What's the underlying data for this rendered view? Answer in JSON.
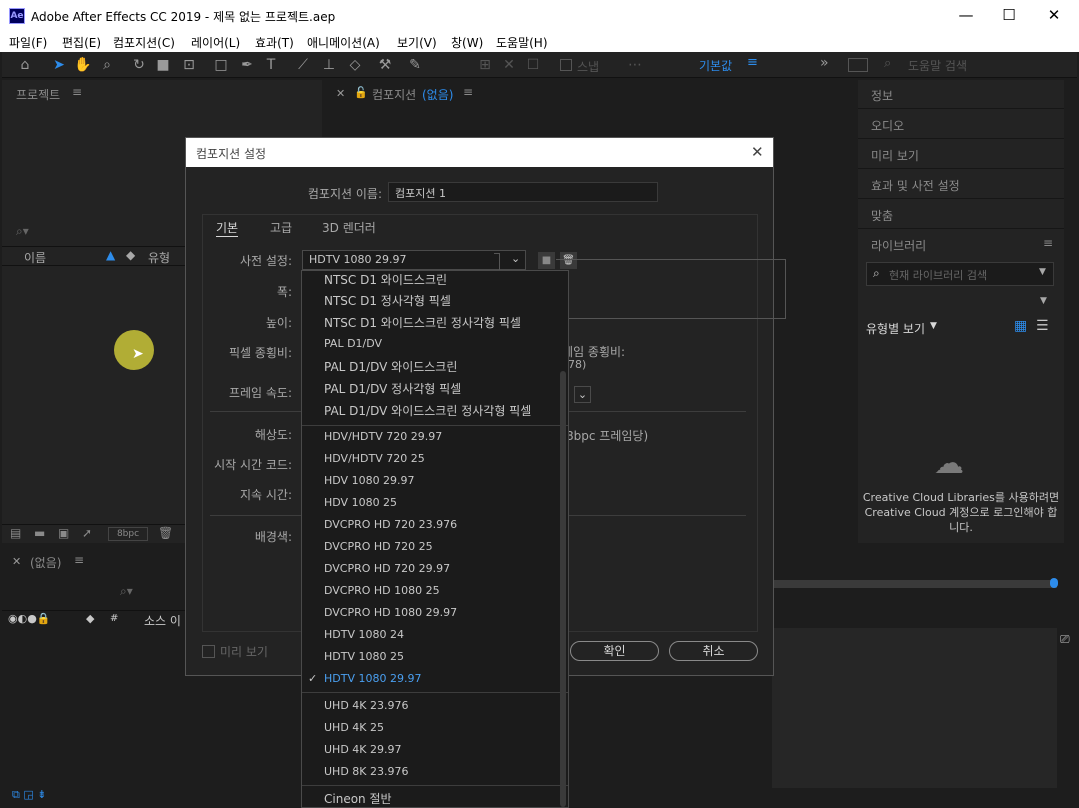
{
  "app": {
    "logo": "Ae",
    "title": "Adobe After Effects CC 2019 - 제목 없는 프로젝트.aep"
  },
  "window_controls": {
    "minimize": "—",
    "maximize": "☐",
    "close": "✕"
  },
  "menu": [
    "파일(F)",
    "편집(E)",
    "컴포지션(C)",
    "레이어(L)",
    "효과(T)",
    "애니메이션(A)",
    "보기(V)",
    "창(W)",
    "도움말(H)"
  ],
  "toolbar": {
    "snap": "스냅",
    "workspace": "기본값",
    "search_placeholder": "도움말 검색"
  },
  "project_panel": {
    "title": "프로젝트",
    "col_name": "이름",
    "col_type": "유형",
    "bpc": "8bpc"
  },
  "comp_panel": {
    "title": "컴포지션",
    "title_accent": "(없음)"
  },
  "right_panel": {
    "items": [
      "정보",
      "오디오",
      "미리 보기",
      "효과 및 사전 설정",
      "맞춤"
    ],
    "library": "라이브러리",
    "library_search": "현재 라이브러리 검색",
    "view_by_type": "유형별 보기",
    "cc_message": "Creative Cloud Libraries를 사용하려면 Creative Cloud 계정으로 로그인해야 합니다."
  },
  "timeline": {
    "title": "(없음)",
    "col_num": "#",
    "col_source": "소스 이"
  },
  "dialog": {
    "title": "컴포지션 설정",
    "comp_name_label": "컴포지션 이름:",
    "comp_name_value": "컴포지션 1",
    "tabs": [
      "기본",
      "고급",
      "3D 렌더러"
    ],
    "preset_label": "사전 설정:",
    "preset_value": "HDTV 1080 29.97",
    "width_label": "폭:",
    "height_label": "높이:",
    "par_label": "픽셀 종횡비:",
    "fps_label": "프레임 속도:",
    "resolution_label": "해상도:",
    "start_tc_label": "시작 시간 코드:",
    "duration_label": "지속 시간:",
    "bg_label": "배경색:",
    "aspect_partial": "프레임 종횡비:",
    "aspect_value_partial": "78)",
    "resolution_partial": "8bpc 프레임당)",
    "preview_label": "미리 보기",
    "ok": "확인",
    "cancel": "취소"
  },
  "dropdown": {
    "group1": [
      "NTSC D1 와이드스크린",
      "NTSC D1 정사각형 픽셀",
      "NTSC D1 와이드스크린 정사각형 픽셀",
      "PAL D1/DV",
      "PAL D1/DV 와이드스크린",
      "PAL D1/DV 정사각형 픽셀",
      "PAL D1/DV 와이드스크린 정사각형 픽셀"
    ],
    "group2": [
      "HDV/HDTV 720 29.97",
      "HDV/HDTV 720 25",
      "HDV 1080 29.97",
      "HDV 1080 25",
      "DVCPRO HD 720 23.976",
      "DVCPRO HD 720 25",
      "DVCPRO HD 720 29.97",
      "DVCPRO HD 1080 25",
      "DVCPRO HD 1080 29.97",
      "HDTV 1080 24",
      "HDTV 1080 25",
      "HDTV 1080 29.97"
    ],
    "group3": [
      "UHD 4K 23.976",
      "UHD 4K 25",
      "UHD 4K 29.97",
      "UHD 8K 23.976"
    ],
    "group4": [
      "Cineon 절반"
    ],
    "selected": "HDTV 1080 29.97",
    "check": "✓"
  },
  "colors": {
    "accent": "#2d8ceb",
    "selected_text": "#4a9ff0",
    "cursor_highlight": "#d4d03a"
  }
}
